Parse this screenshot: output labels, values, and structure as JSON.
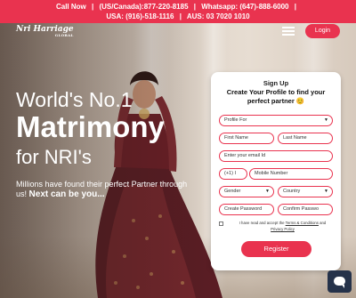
{
  "topbar": {
    "line1_call": "Call Now",
    "line1_us": "(US/Canada):877-220-8185",
    "line1_whatsapp": "Whatsapp: (647)-888-6000",
    "line2_usa": "USA: (916)-518-1116",
    "line2_aus": "AUS: 03 7020 1010",
    "separator": "|"
  },
  "header": {
    "logo_text": "Nri Harriage",
    "logo_small": "GLOBAL",
    "login_label": "Login"
  },
  "hero": {
    "line1": "World's No.1",
    "line2": "Matrimony",
    "line3": "for NRI's",
    "sub_text": "Millions have found their perfect Partner through us!",
    "sub_bold": "Next can be you..."
  },
  "signup": {
    "title": "Sign Up",
    "subtitle": "Create Your Profile to find your perfect partner 😊",
    "profile_for_placeholder": "Profile For",
    "first_name_placeholder": "First Name",
    "last_name_placeholder": "Last Name",
    "email_placeholder": "Enter your email Id",
    "country_code": "(+1) I",
    "mobile_placeholder": "Mobile Number",
    "gender_placeholder": "Gender",
    "country_placeholder": "Country",
    "password_placeholder": "Create Password",
    "confirm_password_placeholder": "Confirm Passwo",
    "consent_prefix": "I have read and accept the ",
    "terms_link": "Terms & Conditions",
    "consent_and": " and ",
    "privacy_link": "Privacy Policy",
    "register_label": "Register"
  },
  "colors": {
    "accent": "#e9334f",
    "chat_bg": "#25324a"
  },
  "icons": {
    "menu": "hamburger-menu-icon",
    "chat": "chat-bubble-icon",
    "dropdown": "caret-down-icon"
  }
}
